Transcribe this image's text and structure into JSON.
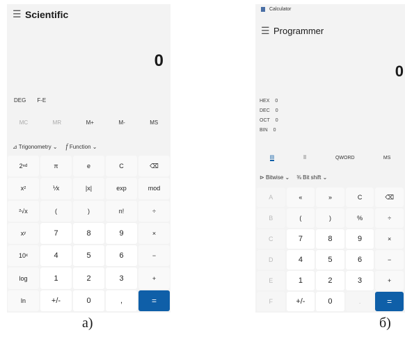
{
  "left": {
    "mode": "Scientific",
    "display": "0",
    "angle_row": [
      "DEG",
      "F-E"
    ],
    "memory": [
      "MC",
      "MR",
      "M+",
      "M-",
      "MS"
    ],
    "toolbar": {
      "trig": "Trigonometry",
      "func": "Function"
    },
    "keys": [
      [
        "2ⁿᵈ",
        "π",
        "e",
        "C",
        "⌫"
      ],
      [
        "x²",
        "⅟x",
        "|x|",
        "exp",
        "mod"
      ],
      [
        "²√x",
        "(",
        ")",
        "n!",
        "÷"
      ],
      [
        "xʸ",
        "7",
        "8",
        "9",
        "×"
      ],
      [
        "10ˣ",
        "4",
        "5",
        "6",
        "−"
      ],
      [
        "log",
        "1",
        "2",
        "3",
        "+"
      ],
      [
        "ln",
        "+/-",
        "0",
        ",",
        "="
      ]
    ],
    "caption": "а)"
  },
  "right": {
    "app_title": "Calculator",
    "mode": "Programmer",
    "display": "0",
    "radix": [
      {
        "name": "HEX",
        "value": "0"
      },
      {
        "name": "DEC",
        "value": "0"
      },
      {
        "name": "OCT",
        "value": "0"
      },
      {
        "name": "BIN",
        "value": "0"
      }
    ],
    "word_row": [
      "QWORD",
      "MS"
    ],
    "toolbar": {
      "bitwise": "Bitwise",
      "bitshift": "Bit shift"
    },
    "keys": [
      [
        "A",
        "«",
        "»",
        "C",
        "⌫"
      ],
      [
        "B",
        "(",
        ")",
        "%",
        "÷"
      ],
      [
        "C",
        "7",
        "8",
        "9",
        "×"
      ],
      [
        "D",
        "4",
        "5",
        "6",
        "−"
      ],
      [
        "E",
        "1",
        "2",
        "3",
        "+"
      ],
      [
        "F",
        "+/-",
        "0",
        ".",
        "="
      ]
    ],
    "caption": "б)"
  }
}
